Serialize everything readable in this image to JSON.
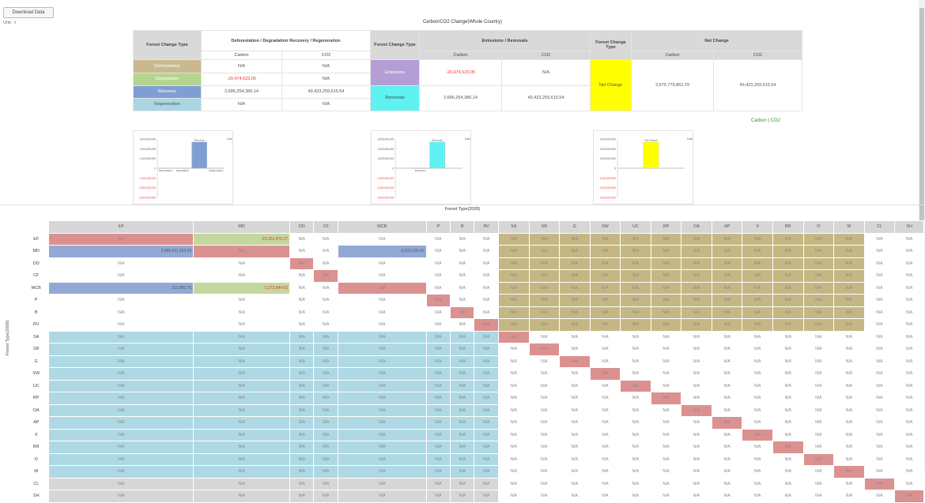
{
  "toolbar": {
    "download_label": "Download Data"
  },
  "unit_label": "Unit : t",
  "summary_title": "Carbon/CO2 Change(Whole Country)",
  "summary": {
    "forest_change_type_header": "Forest Change Type",
    "defo_header": "Deforestation / Degradation Recovery / Regeneration",
    "forest_change_type_header2": "Forest Change Type",
    "em_header": "Emissions / Removals",
    "forest_change_type_header3": "Forest Change Type",
    "net_header": "Net Change",
    "carbon": "Carbon",
    "co2": "CO2",
    "rows": [
      {
        "label": "Deforestation",
        "color": "#c8ba8e",
        "carbon": "N/A",
        "co2": "N/A"
      },
      {
        "label": "Degradation",
        "color": "#b5d48e",
        "carbon": "-20,474,523.05",
        "co2": "N/A"
      },
      {
        "label": "Recovery",
        "color": "#7f9fd4",
        "carbon": "2,686,254,386.14",
        "co2": "49,423,259,615.54"
      },
      {
        "label": "Regeneration",
        "color": "#a9d6e2",
        "carbon": "N/A",
        "co2": "N/A"
      }
    ],
    "emissions": {
      "label": "Emissions",
      "color": "#b59ed6",
      "carbon": "-20,474,523.05",
      "co2": "N/A"
    },
    "removals": {
      "label": "Removals",
      "color": "#5ff2f2",
      "carbon": "2,686,254,386.14",
      "co2": "49,423,259,615.54"
    },
    "net": {
      "label": "Net Change",
      "color": "#ffff00",
      "carbon": "2,675,779,862.29",
      "co2": "49,423,259,615.54"
    }
  },
  "legend": {
    "carbon": "Carbon",
    "sep": "|",
    "co2": "CO2"
  },
  "charts": [
    {
      "legend": "Carbon",
      "ticks": [
        "3,000,000,000",
        "2,000,000,000",
        "1,000,000,000",
        "0",
        "-1,000,000,000",
        "-2,000,000,000",
        "-3,000,000,000"
      ],
      "bars": [
        {
          "label": "Deforestation",
          "value": 0,
          "color": "#c8ba8e"
        },
        {
          "label": "Degradation",
          "value": -20474523.05,
          "color": "#b5d48e"
        },
        {
          "label": "Recovery",
          "value": 2686254386.14,
          "color": "#7f9fd4"
        },
        {
          "label": "Regeneration",
          "value": 0,
          "color": "#a9d6e2"
        }
      ]
    },
    {
      "legend": "Carbon",
      "ticks": [
        "3,000,000,000",
        "2,000,000,000",
        "1,000,000,000",
        "0",
        "-1,000,000,000",
        "-2,000,000,000",
        "-3,000,000,000"
      ],
      "bars": [
        {
          "label": "Emissions",
          "value": -20474523.05,
          "color": "#b59ed6"
        },
        {
          "label": "Removals",
          "value": 2686254386.14,
          "color": "#5ff2f2"
        }
      ]
    },
    {
      "legend": "Carbon",
      "ticks": [
        "3,000,000,000",
        "2,000,000,000",
        "1,000,000,000",
        "0",
        "-1,000,000,000",
        "-2,000,000,000",
        "-3,000,000,000"
      ],
      "bars": [
        {
          "label": "Net Change",
          "value": 2675779862.29,
          "color": "#ffff00"
        }
      ]
    }
  ],
  "matrix_title": "Forest Type(2005)",
  "matrix_yaxis": "Forest Type(2000)",
  "matrix": {
    "columns": [
      "EF",
      "MD",
      "DD",
      "CF",
      "MCB",
      "P",
      "B",
      "RV",
      "SA",
      "SR",
      "G",
      "SW",
      "UC",
      "RP",
      "OA",
      "AP",
      "II",
      "BR",
      "O",
      "W",
      "CL",
      "SH"
    ],
    "rows": [
      "EF",
      "MD",
      "DD",
      "CF",
      "MCB",
      "P",
      "B",
      "RV",
      "SA",
      "SR",
      "G",
      "SW",
      "UC",
      "RP",
      "OA",
      "AP",
      "II",
      "BR",
      "O",
      "W",
      "CL",
      "SH"
    ],
    "values": {
      "EF-MD": "-15,251,670.17",
      "MD-EF": "2,585,611,032.55",
      "MD-MCB": "6,522,265.40",
      "MCB-EF": "321,082.76",
      "MCB-MD": "-2,272,844.63"
    },
    "colors": {
      "diag": "#dc9191",
      "recovery": "#93a9d5",
      "degradation": "#c3d79e",
      "deforestation": "#c4b784",
      "regeneration": "#aed8e3",
      "other": "#d6d6d6",
      "default": "#ffffff"
    }
  }
}
